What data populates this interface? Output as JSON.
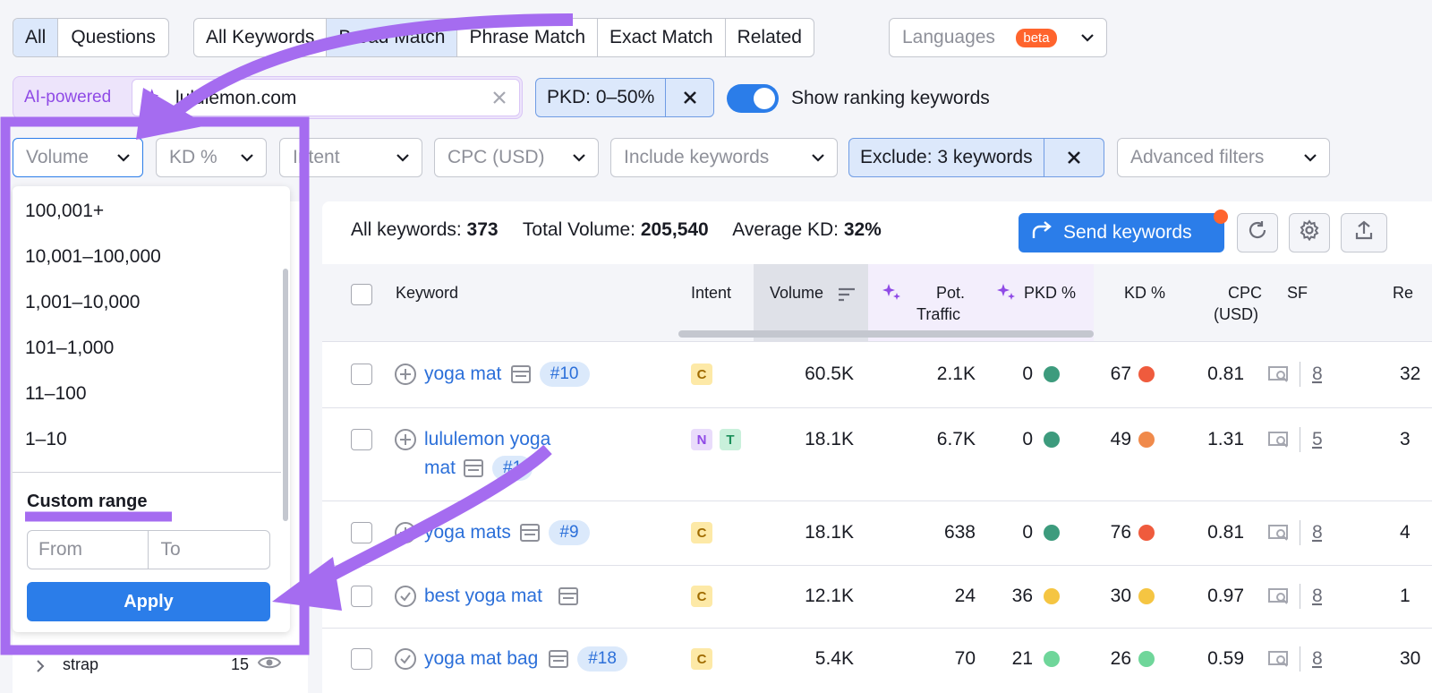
{
  "top_tabs": {
    "scope": [
      "All",
      "Questions"
    ],
    "match": [
      "All Keywords",
      "Broad Match",
      "Phrase Match",
      "Exact Match",
      "Related"
    ],
    "languages": "Languages",
    "beta": "beta"
  },
  "search": {
    "ai_label": "AI-powered",
    "value": "lululemon.com"
  },
  "pkd_filter": "PKD: 0–50%",
  "show_ranking": "Show ranking keywords",
  "filters": {
    "volume": "Volume",
    "kd": "KD %",
    "intent": "Intent",
    "cpc": "CPC (USD)",
    "include": "Include keywords",
    "exclude": "Exclude: 3 keywords",
    "advanced": "Advanced filters"
  },
  "volume_menu": {
    "options": [
      "100,001+",
      "10,001–100,000",
      "1,001–10,000",
      "101–1,000",
      "11–100",
      "1–10"
    ],
    "custom_label": "Custom range",
    "from_placeholder": "From",
    "to_placeholder": "To",
    "apply": "Apply"
  },
  "sidebar_row": {
    "label": "strap",
    "count": "15"
  },
  "summary": {
    "all_label": "All keywords:",
    "all_value": "373",
    "vol_label": "Total Volume:",
    "vol_value": "205,540",
    "kd_label": "Average KD:",
    "kd_value": "32%"
  },
  "send_keywords": "Send keywords",
  "columns": {
    "keyword": "Keyword",
    "intent": "Intent",
    "volume": "Volume",
    "pot_traffic_1": "Pot.",
    "pot_traffic_2": "Traffic",
    "pkd": "PKD %",
    "kd": "KD %",
    "cpc_1": "CPC",
    "cpc_2": "(USD)",
    "sf": "SF",
    "re": "Re"
  },
  "rows": [
    {
      "kw": "yoga mat",
      "kw2": "",
      "pos": "#10",
      "intents": [
        "C"
      ],
      "volume": "60.5K",
      "traffic": "2.1K",
      "pkd": "0",
      "pkd_color": "#3d9b7d",
      "kd": "67",
      "kd_color": "#ef5b3d",
      "cpc": "0.81",
      "sf": "8",
      "re": "32"
    },
    {
      "kw": "lululemon yoga",
      "kw2": "mat",
      "pos": "#1",
      "intents": [
        "N",
        "T"
      ],
      "volume": "18.1K",
      "traffic": "6.7K",
      "pkd": "0",
      "pkd_color": "#3d9b7d",
      "kd": "49",
      "kd_color": "#f08a4b",
      "cpc": "1.31",
      "sf": "5",
      "re": "3"
    },
    {
      "kw": "yoga mats",
      "kw2": "",
      "pos": "#9",
      "intents": [
        "C"
      ],
      "volume": "18.1K",
      "traffic": "638",
      "pkd": "0",
      "pkd_color": "#3d9b7d",
      "kd": "76",
      "kd_color": "#ef5b3d",
      "cpc": "0.81",
      "sf": "8",
      "re": "4"
    },
    {
      "kw": "best yoga mat",
      "kw2": "",
      "pos": "",
      "intents": [
        "C"
      ],
      "volume": "12.1K",
      "traffic": "24",
      "pkd": "36",
      "pkd_color": "#f5c542",
      "kd": "30",
      "kd_color": "#f5c542",
      "cpc": "0.97",
      "sf": "8",
      "re": "1"
    },
    {
      "kw": "yoga mat bag",
      "kw2": "",
      "pos": "#18",
      "intents": [
        "C"
      ],
      "volume": "5.4K",
      "traffic": "70",
      "pkd": "21",
      "pkd_color": "#6fd69a",
      "kd": "26",
      "kd_color": "#6fd69a",
      "cpc": "0.59",
      "sf": "8",
      "re": "30"
    }
  ]
}
